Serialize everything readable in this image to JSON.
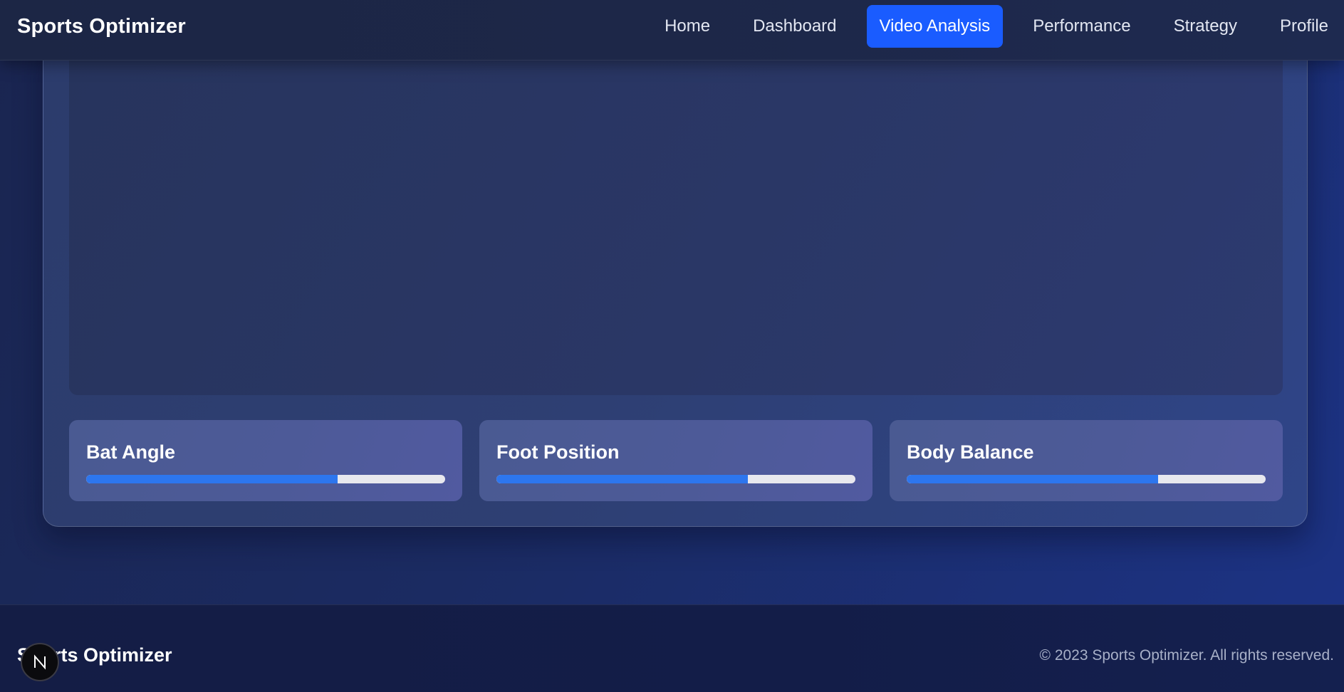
{
  "app": {
    "brand": "Sports Optimizer"
  },
  "nav": {
    "items": [
      {
        "label": "Home",
        "active": false
      },
      {
        "label": "Dashboard",
        "active": false
      },
      {
        "label": "Video Analysis",
        "active": true
      },
      {
        "label": "Performance",
        "active": false
      },
      {
        "label": "Strategy",
        "active": false
      },
      {
        "label": "Profile",
        "active": false
      }
    ]
  },
  "metrics": [
    {
      "label": "Bat Angle",
      "value": 0.7
    },
    {
      "label": "Foot Position",
      "value": 0.7
    },
    {
      "label": "Body Balance",
      "value": 0.7
    }
  ],
  "footer": {
    "brand": "Sports Optimizer",
    "copyright": "© 2023 Sports Optimizer. All rights reserved."
  },
  "badge": {
    "icon": "n-logo-icon"
  },
  "colors": {
    "accent": "#1a5cff",
    "bar_fill": "#2d76ee",
    "bar_track": "#e8e8ee"
  }
}
